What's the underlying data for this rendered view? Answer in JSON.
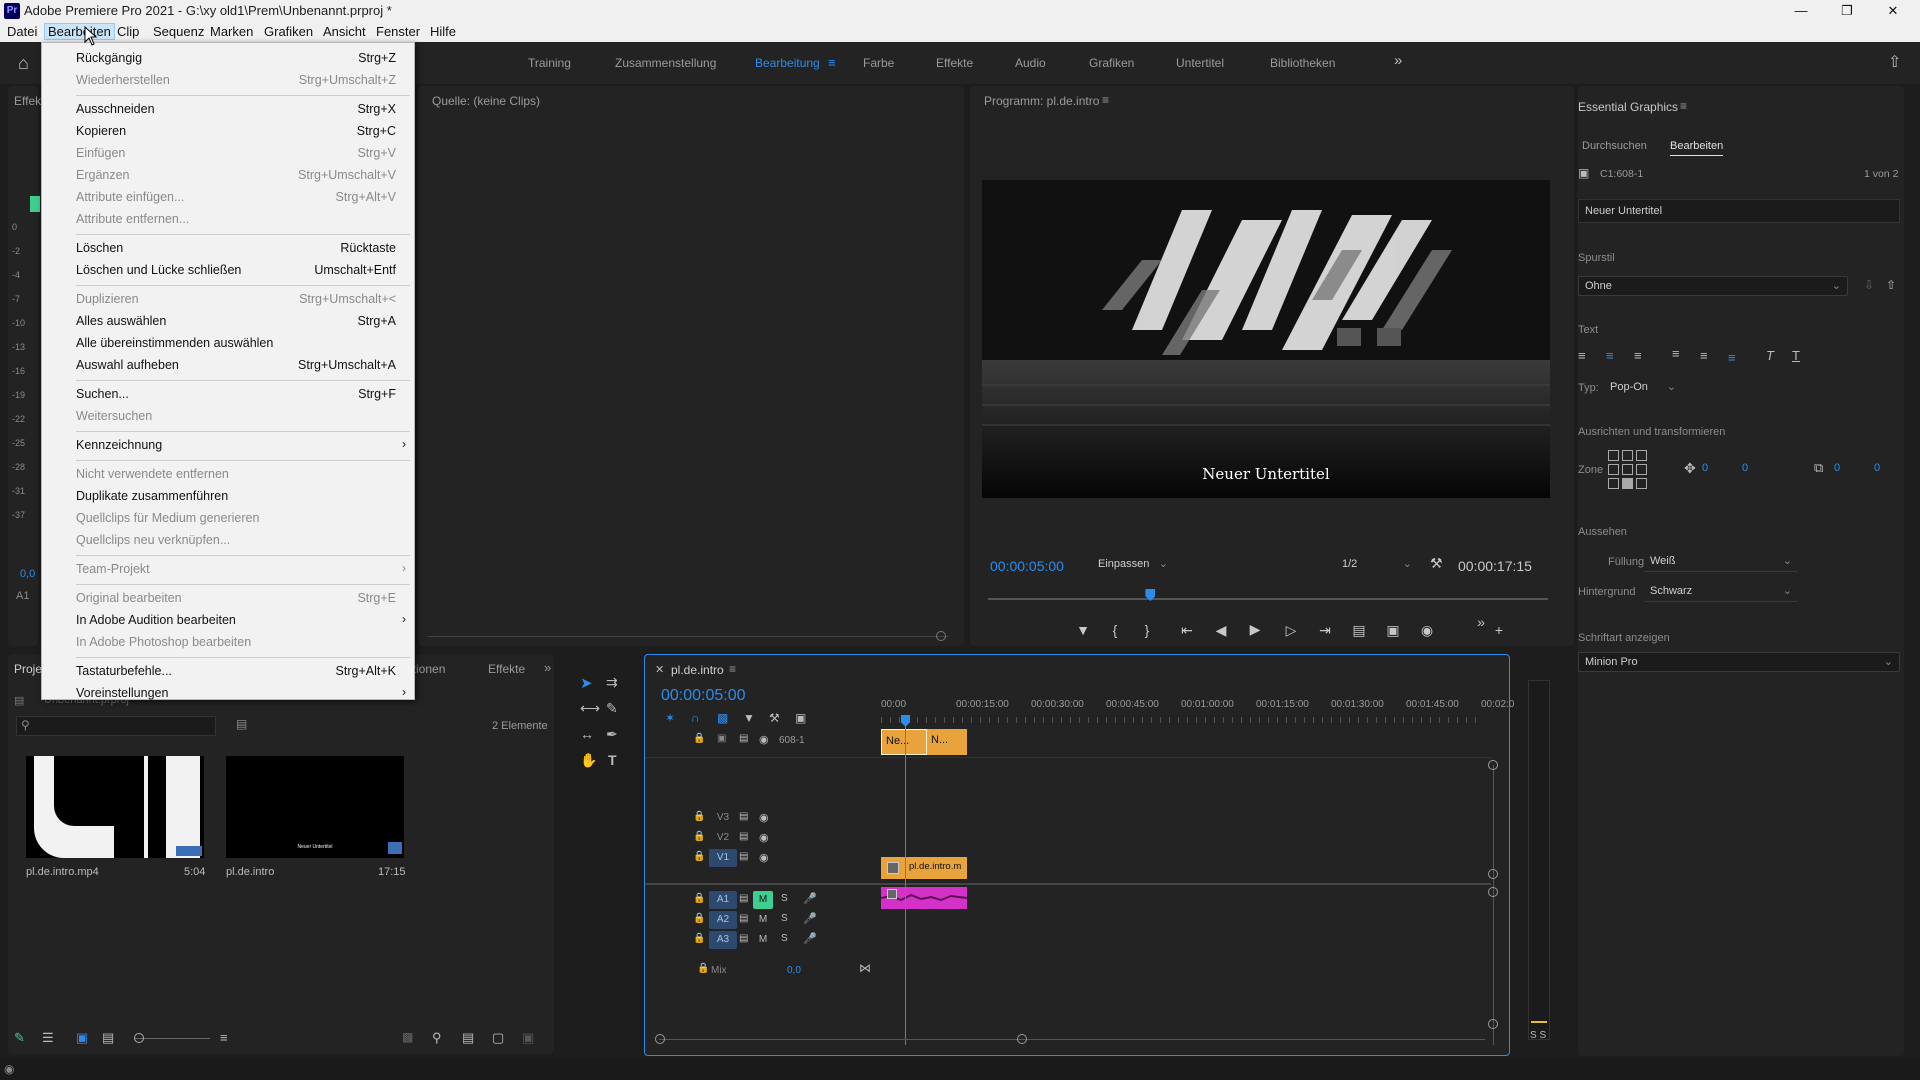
{
  "window": {
    "title": "Adobe Premiere Pro 2021 - G:\\xy old1\\Prem\\Unbenannt.prproj *",
    "logo": "Pr"
  },
  "menubar": [
    "Datei",
    "Bearbeiten",
    "Clip",
    "Sequenz",
    "Marken",
    "Grafiken",
    "Ansicht",
    "Fenster",
    "Hilfe"
  ],
  "workspaces": [
    "Training",
    "Zusammenstellung",
    "Bearbeitung",
    "Farbe",
    "Effekte",
    "Audio",
    "Grafiken",
    "Untertitel",
    "Bibliotheken"
  ],
  "active_workspace": "Bearbeitung",
  "edit_menu": [
    {
      "label": "Rückgängig",
      "shortcut": "Strg+Z",
      "disabled": false
    },
    {
      "label": "Wiederherstellen",
      "shortcut": "Strg+Umschalt+Z",
      "disabled": true
    },
    {
      "label": "Ausschneiden",
      "shortcut": "Strg+X",
      "disabled": false
    },
    {
      "label": "Kopieren",
      "shortcut": "Strg+C",
      "disabled": false
    },
    {
      "label": "Einfügen",
      "shortcut": "Strg+V",
      "disabled": true
    },
    {
      "label": "Ergänzen",
      "shortcut": "Strg+Umschalt+V",
      "disabled": true
    },
    {
      "label": "Attribute einfügen...",
      "shortcut": "Strg+Alt+V",
      "disabled": true
    },
    {
      "label": "Attribute entfernen...",
      "shortcut": "",
      "disabled": true
    },
    {
      "label": "Löschen",
      "shortcut": "Rücktaste",
      "disabled": false
    },
    {
      "label": "Löschen und Lücke schließen",
      "shortcut": "Umschalt+Entf",
      "disabled": false
    },
    {
      "label": "Duplizieren",
      "shortcut": "Strg+Umschalt+<",
      "disabled": true
    },
    {
      "label": "Alles auswählen",
      "shortcut": "Strg+A",
      "disabled": false
    },
    {
      "label": "Alle übereinstimmenden auswählen",
      "shortcut": "",
      "disabled": false
    },
    {
      "label": "Auswahl aufheben",
      "shortcut": "Strg+Umschalt+A",
      "disabled": false
    },
    {
      "label": "Suchen...",
      "shortcut": "Strg+F",
      "disabled": false
    },
    {
      "label": "Weitersuchen",
      "shortcut": "",
      "disabled": true
    },
    {
      "label": "Kennzeichnung",
      "shortcut": "",
      "disabled": false,
      "submenu": true
    },
    {
      "label": "Nicht verwendete entfernen",
      "shortcut": "",
      "disabled": true
    },
    {
      "label": "Duplikate zusammenführen",
      "shortcut": "",
      "disabled": false
    },
    {
      "label": "Quellclips für Medium generieren",
      "shortcut": "",
      "disabled": true
    },
    {
      "label": "Quellclips neu verknüpfen...",
      "shortcut": "",
      "disabled": true
    },
    {
      "label": "Team-Projekt",
      "shortcut": "",
      "disabled": true,
      "submenu": true
    },
    {
      "label": "Original bearbeiten",
      "shortcut": "Strg+E",
      "disabled": true
    },
    {
      "label": "In Adobe Audition bearbeiten",
      "shortcut": "",
      "disabled": false,
      "submenu": true
    },
    {
      "label": "In Adobe Photoshop bearbeiten",
      "shortcut": "",
      "disabled": true
    },
    {
      "label": "Tastaturbefehle...",
      "shortcut": "Strg+Alt+K",
      "disabled": false
    },
    {
      "label": "Voreinstellungen",
      "shortcut": "",
      "disabled": false,
      "submenu": true
    }
  ],
  "source_panel": {
    "title": "Quelle: (keine Clips)",
    "left_tab": "Effekt"
  },
  "program": {
    "title": "Programm: pl.de.intro",
    "subtitle_text": "Neuer Untertitel",
    "timecode": "00:00:05:00",
    "fit": "Einpassen",
    "resolution": "1/2",
    "duration": "00:00:17:15",
    "playhead": 0.29
  },
  "essential_graphics": {
    "title": "Essential Graphics",
    "tabs": [
      "Durchsuchen",
      "Bearbeiten"
    ],
    "active_tab": "Bearbeiten",
    "caption_id": "C1:608-1",
    "counter": "1 von 2",
    "caption_text": "Neuer Untertitel",
    "track_style_label": "Spurstil",
    "track_style": "Ohne",
    "text_label": "Text",
    "type_label": "Typ:",
    "type_value": "Pop-On",
    "align_label": "Ausrichten und transformieren",
    "zone_label": "Zone",
    "pos_x": "0",
    "pos_y": "0",
    "size_x": "0",
    "size_y": "0",
    "appearance_label": "Aussehen",
    "fill_label": "Füllung",
    "fill_value": "Weiß",
    "bg_label": "Hintergrund",
    "bg_value": "Schwarz",
    "font_section": "Schriftart anzeigen",
    "font_value": "Minion Pro"
  },
  "project": {
    "tab": "Proje",
    "filename": "Unbenannt.prproj",
    "tabs_other": [
      "ationen",
      "Effekte"
    ],
    "count": "2 Elemente",
    "items": [
      {
        "name": "pl.de.intro.mp4",
        "duration": "5:04"
      },
      {
        "name": "pl.de.intro",
        "duration": "17:15"
      }
    ],
    "thumb_caption": "Neuer Untertitel"
  },
  "timeline": {
    "tab": "pl.de.intro",
    "timecode": "00:00:05:00",
    "ruler": [
      "00:00",
      "00:00:15:00",
      "00:00:30:00",
      "00:00:45:00",
      "00:01:00:00",
      "00:01:15:00",
      "00:01:30:00",
      "00:01:45:00",
      "00:02:0"
    ],
    "caption_track": "608-1",
    "caption_clips": [
      "Ne...",
      "N..."
    ],
    "video_tracks": [
      "V3",
      "V2",
      "V1"
    ],
    "audio_tracks": [
      "A1",
      "A2",
      "A3"
    ],
    "video_clip": "pl.de.intro.m",
    "mix_label": "Mix",
    "mix_value": "0,0",
    "mute": "M",
    "solo": "S"
  },
  "meter": {
    "db_marks": [
      "0",
      "-2",
      "-4",
      "-7",
      "-10",
      "-13",
      "-16",
      "-19",
      "-22",
      "-25",
      "-28",
      "-31",
      "-37"
    ],
    "channel_label": "A1",
    "readout": "0,0",
    "solo_labels": "S S"
  },
  "colors": {
    "accent": "#2d8ceb",
    "caption_clip": "#e8a33c",
    "video_clip": "#e8a33c",
    "audio_clip": "#d431c8",
    "mute_active": "#3ecf8e"
  }
}
